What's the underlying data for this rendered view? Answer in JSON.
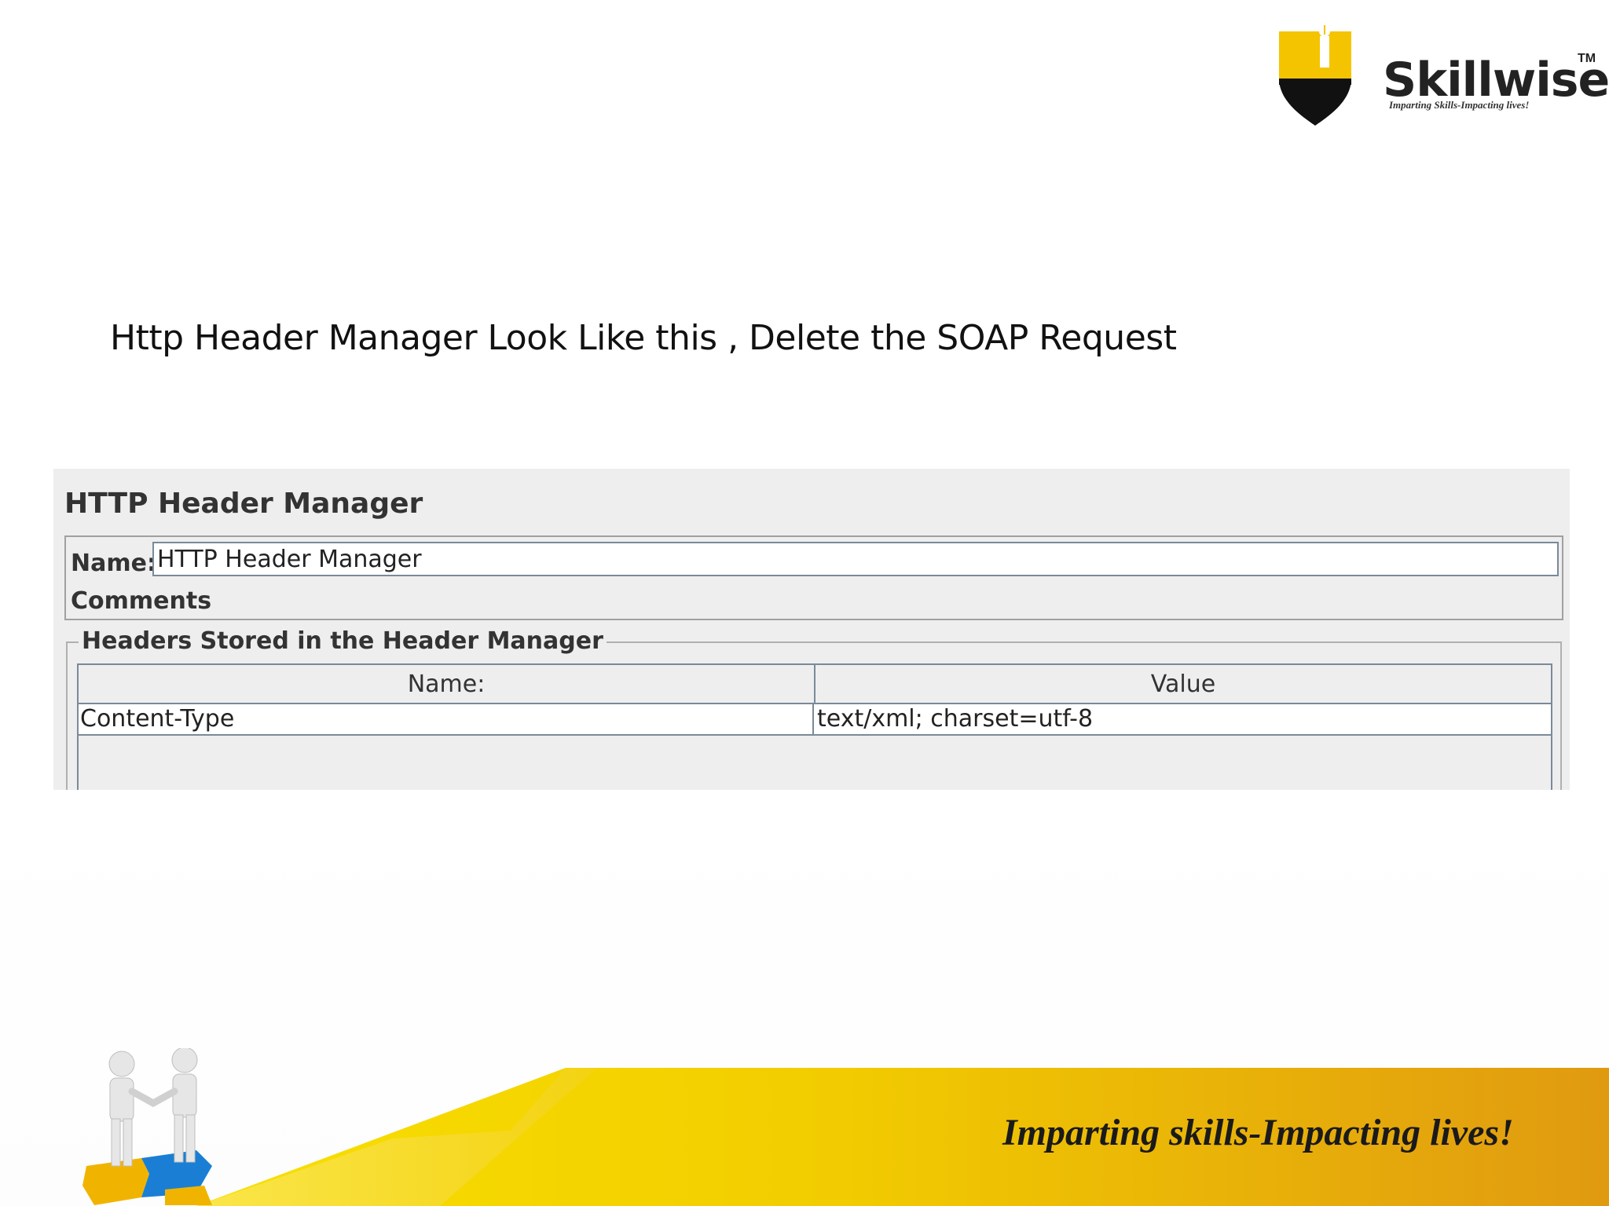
{
  "logo": {
    "brand": "Skillwise",
    "trademark": "TM",
    "tagline": "Imparting Skills-Impacting lives!"
  },
  "slide": {
    "instruction": "Http Header Manager Look Like this , Delete the SOAP Request"
  },
  "panel": {
    "title": "HTTP Header Manager",
    "name_label": "Name:",
    "name_value": "HTTP Header Manager",
    "comments_label": "Comments:",
    "headers_group_label": "Headers Stored in the Header Manager",
    "table": {
      "columns": [
        "Name:",
        "Value"
      ],
      "rows": [
        {
          "name": "Content-Type",
          "value": "text/xml; charset=utf-8"
        }
      ]
    }
  },
  "footer": {
    "tagline": "Imparting skills-Impacting lives!"
  },
  "colors": {
    "brand_yellow": "#f5d000",
    "brand_orange": "#e0a010",
    "panel_bg": "#eeeeee",
    "table_border": "#7a8a99"
  }
}
